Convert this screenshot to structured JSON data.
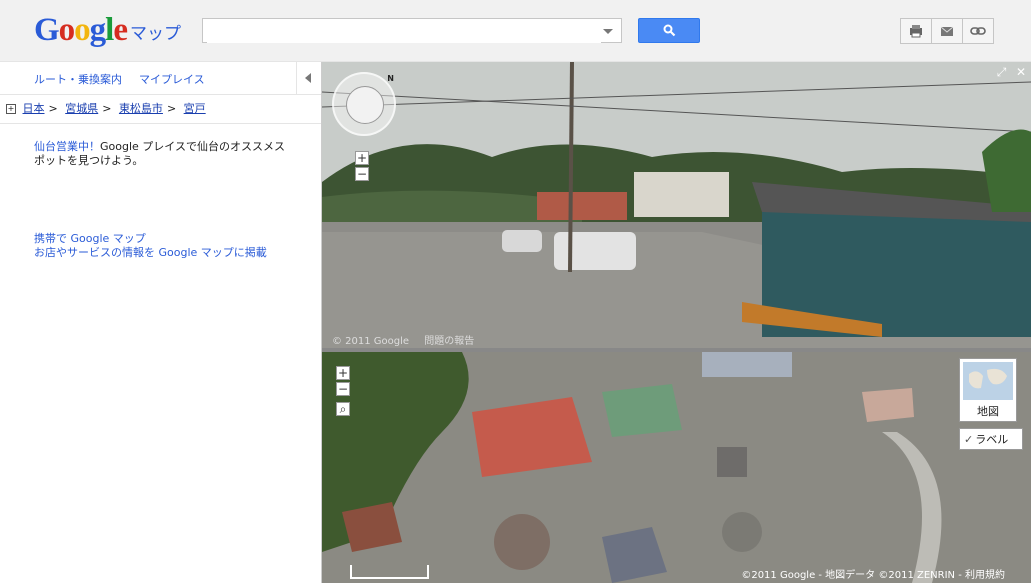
{
  "header": {
    "logo_text": "Google",
    "logo_sub": "マップ",
    "search": {
      "value": "",
      "placeholder": ""
    },
    "search_button_icon": "search-icon",
    "tools": [
      "print-icon",
      "mail-icon",
      "link-icon"
    ]
  },
  "sidebar": {
    "nav": {
      "route": "ルート・乗換案内",
      "myplaces": "マイプレイス"
    },
    "breadcrumb": [
      "日本",
      "宮城県",
      "東松島市",
      "宮戸"
    ],
    "promo": {
      "link": "仙台営業中！",
      "text": "Google プレイスで仙台のオススメスポットを見つけよう。"
    },
    "links": [
      "携帯で Google マップ",
      "お店やサービスの情報を Google マップに掲載"
    ]
  },
  "streetview": {
    "copyright": "© 2011 Google",
    "report": "問題の報告",
    "compass_label": "N"
  },
  "map": {
    "maptype_label": "地図",
    "label_toggle": "ラベル",
    "label_checked": true,
    "copyright": "©2011 Google - 地図データ ©2011 ZENRIN - 利用規約"
  },
  "colors": {
    "accent": "#4a8af4",
    "link": "#2a5bd7"
  }
}
